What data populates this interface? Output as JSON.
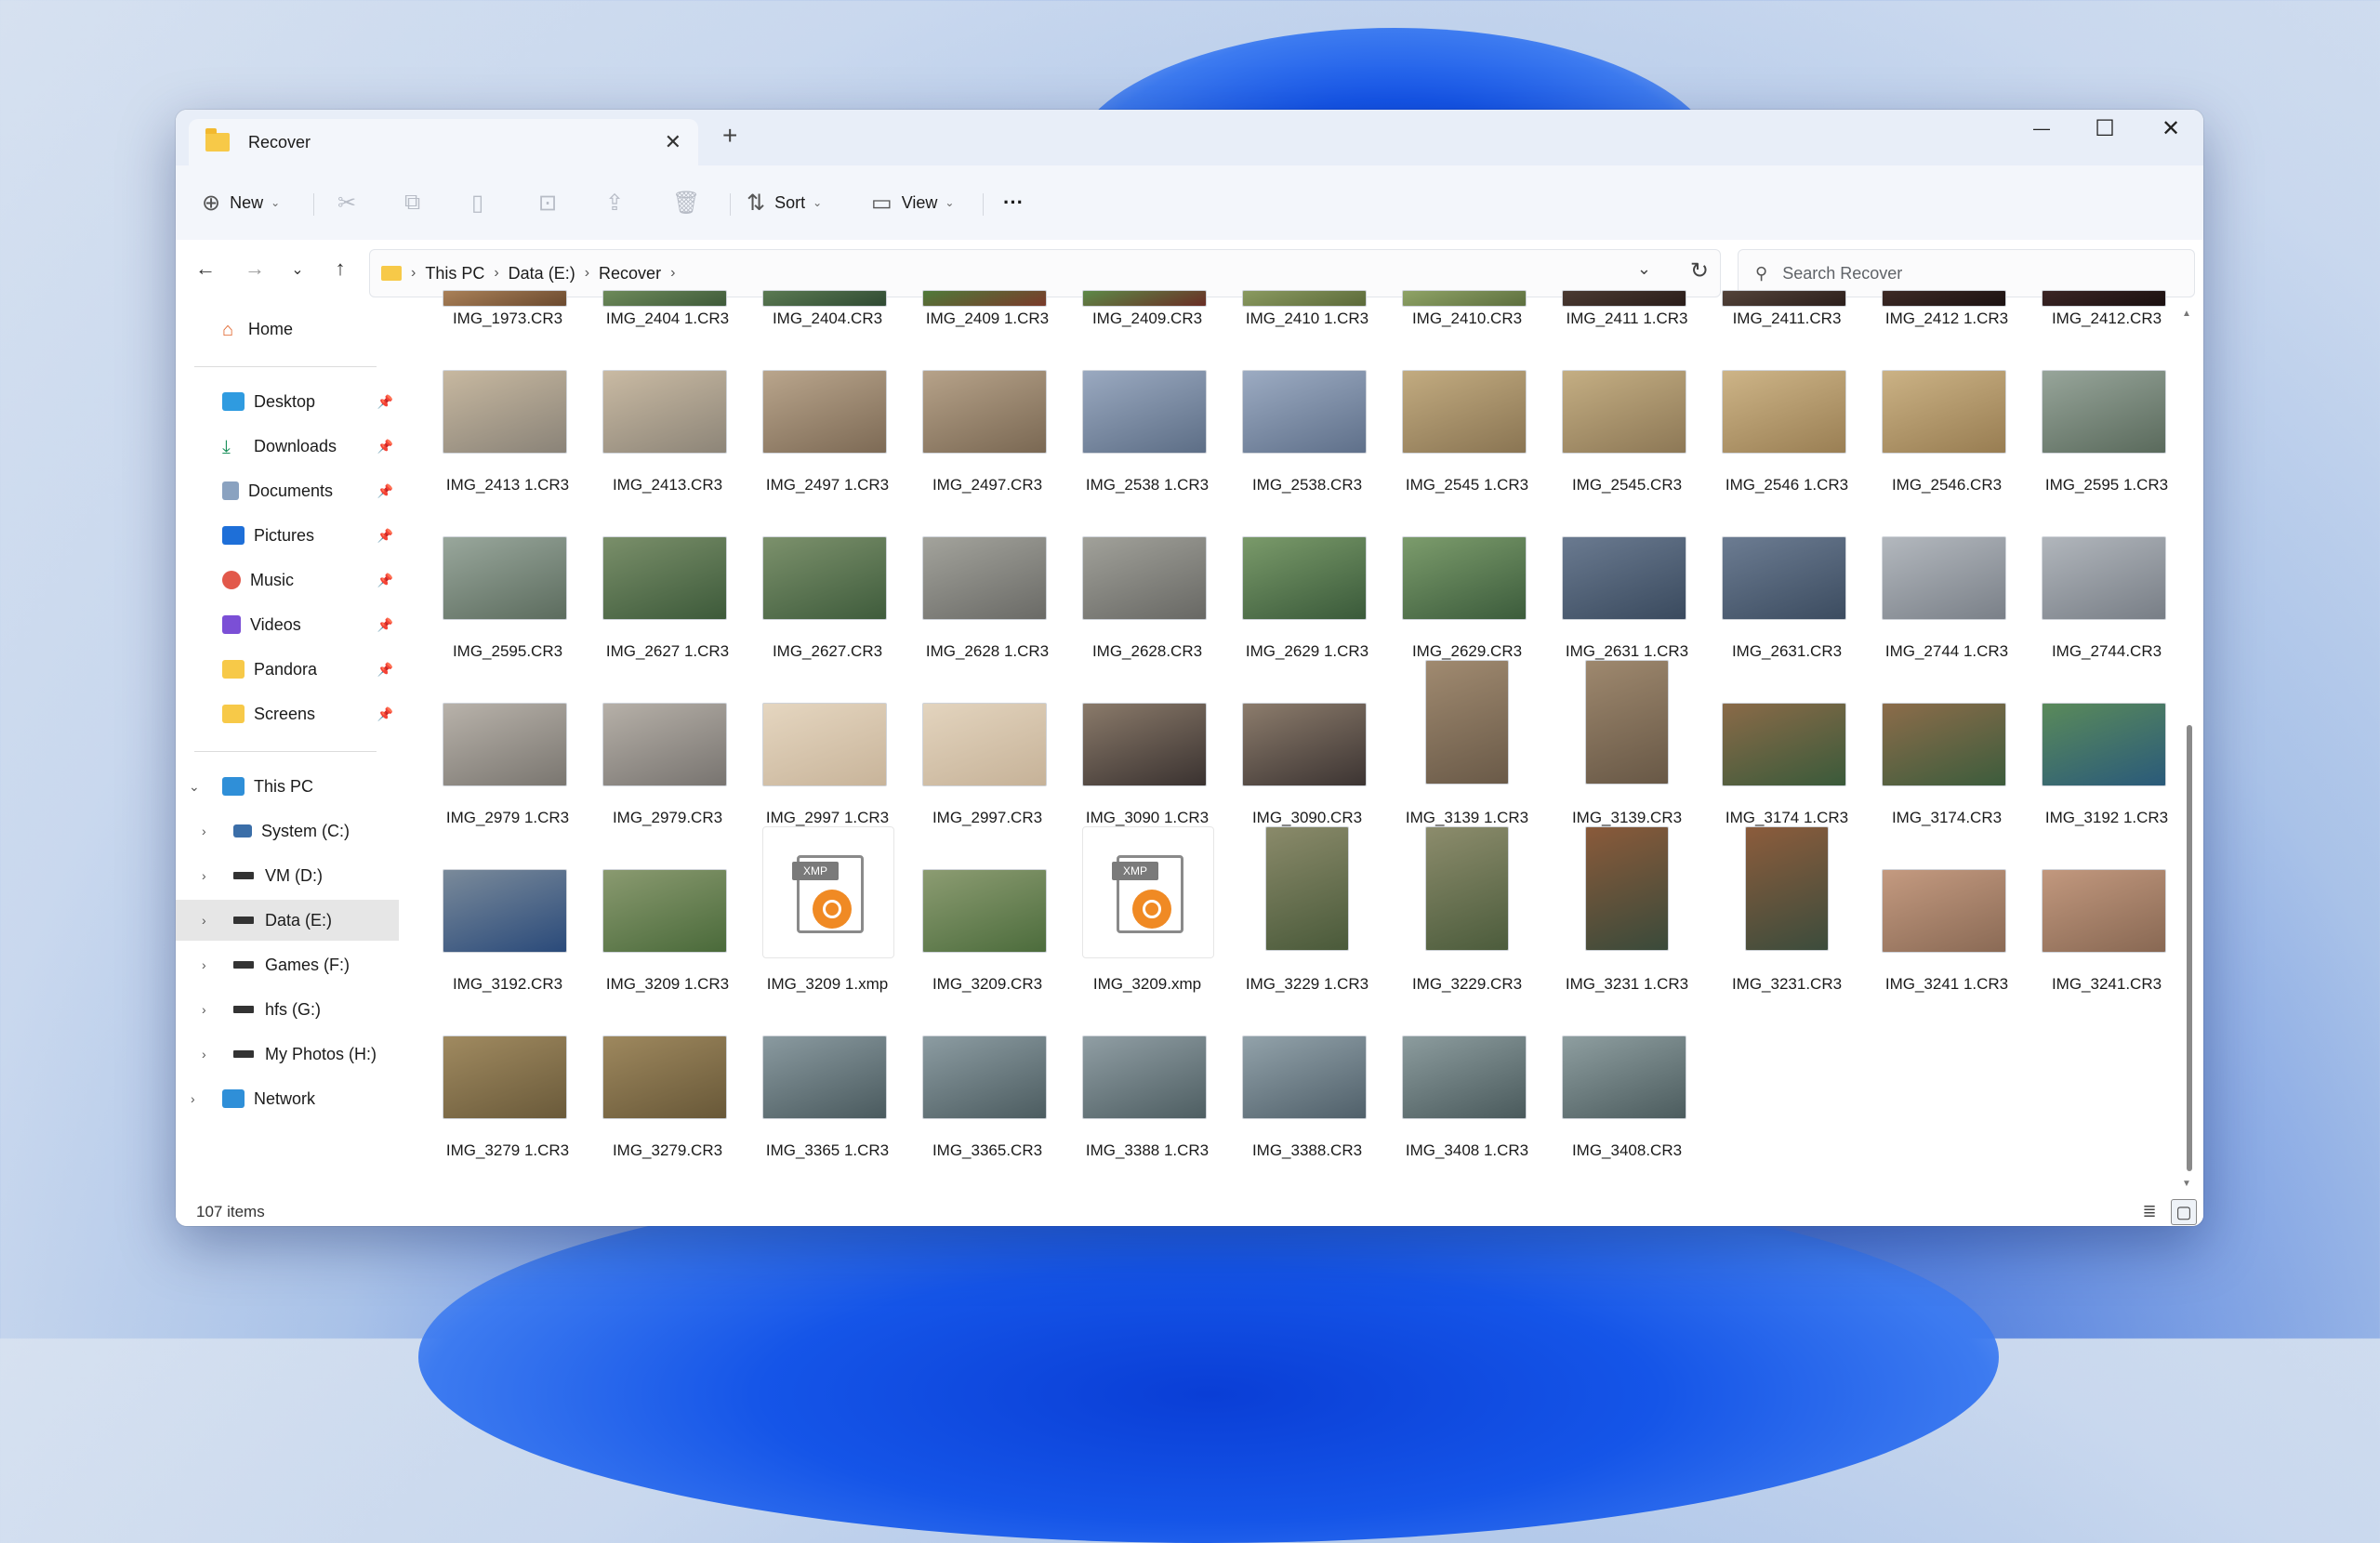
{
  "window": {
    "tab_title": "Recover",
    "tab_close": "✕",
    "new_tab": "+",
    "minimize": "—",
    "maximize": "☐",
    "close": "✕"
  },
  "toolbar": {
    "new_label": "New",
    "sort_label": "Sort",
    "view_label": "View",
    "more": "···"
  },
  "address": {
    "crumbs": [
      "This PC",
      "Data (E:)",
      "Recover"
    ],
    "search_placeholder": "Search Recover"
  },
  "sidebar": {
    "home": "Home",
    "quick": [
      "Desktop",
      "Downloads",
      "Documents",
      "Pictures",
      "Music",
      "Videos",
      "Pandora",
      "Screens"
    ],
    "this_pc": "This PC",
    "drives": [
      "System (C:)",
      "VM (D:)",
      "Data (E:)",
      "Games (F:)",
      "hfs (G:)",
      "My Photos (H:)"
    ],
    "network": "Network"
  },
  "files": [
    "IMG_1973.CR3",
    "IMG_2404 1.CR3",
    "IMG_2404.CR3",
    "IMG_2409 1.CR3",
    "IMG_2409.CR3",
    "IMG_2410 1.CR3",
    "IMG_2410.CR3",
    "IMG_2411 1.CR3",
    "IMG_2411.CR3",
    "IMG_2412 1.CR3",
    "IMG_2412.CR3",
    "IMG_2413 1.CR3",
    "IMG_2413.CR3",
    "IMG_2497 1.CR3",
    "IMG_2497.CR3",
    "IMG_2538 1.CR3",
    "IMG_2538.CR3",
    "IMG_2545 1.CR3",
    "IMG_2545.CR3",
    "IMG_2546 1.CR3",
    "IMG_2546.CR3",
    "IMG_2595 1.CR3",
    "IMG_2595.CR3",
    "IMG_2627 1.CR3",
    "IMG_2627.CR3",
    "IMG_2628 1.CR3",
    "IMG_2628.CR3",
    "IMG_2629 1.CR3",
    "IMG_2629.CR3",
    "IMG_2631 1.CR3",
    "IMG_2631.CR3",
    "IMG_2744 1.CR3",
    "IMG_2744.CR3",
    "IMG_2979 1.CR3",
    "IMG_2979.CR3",
    "IMG_2997 1.CR3",
    "IMG_2997.CR3",
    "IMG_3090 1.CR3",
    "IMG_3090.CR3",
    "IMG_3139 1.CR3",
    "IMG_3139.CR3",
    "IMG_3174 1.CR3",
    "IMG_3174.CR3",
    "IMG_3192 1.CR3",
    "IMG_3192.CR3",
    "IMG_3209 1.CR3",
    "IMG_3209 1.xmp",
    "IMG_3209.CR3",
    "IMG_3209.xmp",
    "IMG_3229 1.CR3",
    "IMG_3229.CR3",
    "IMG_3231 1.CR3",
    "IMG_3231.CR3",
    "IMG_3241 1.CR3",
    "IMG_3241.CR3",
    "IMG_3279 1.CR3",
    "IMG_3279.CR3",
    "IMG_3365 1.CR3",
    "IMG_3365.CR3",
    "IMG_3388 1.CR3",
    "IMG_3388.CR3",
    "IMG_3408 1.CR3",
    "IMG_3408.CR3"
  ],
  "xmp_tag": "XMP",
  "status": {
    "item_count": "107 items"
  }
}
